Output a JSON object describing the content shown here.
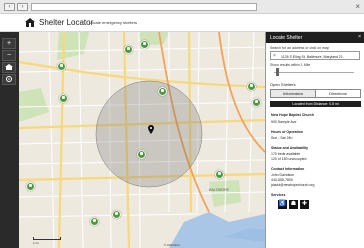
{
  "app": {
    "title": "Shelter Locator",
    "tagline": "Locate emergency shelters"
  },
  "left_bar": {
    "zoom_in": "+",
    "zoom_out": "−"
  },
  "map": {
    "street_labels": [],
    "district_label": "BALTIMORE",
    "scale_label": "1 mi",
    "attribution": "© 2014 Esri"
  },
  "panel": {
    "title": "Locate Shelter",
    "close": "×",
    "search_label": "Search for an address or click on map",
    "search_value": "1126 S Eling St, Baltimore, Maryland 21",
    "show_label": "Show results within 1 Mile",
    "open_shelters": "Open Shelters",
    "tabs": [
      "Information",
      "Directions"
    ],
    "status": "Located from Distance: 0.8 mi",
    "shelter": {
      "name": "New Hope Baptist Church",
      "address": "900 Sample Ave",
      "hours_label": "Hours of Operation",
      "hours": "Sun - Sat 24h",
      "status_label": "Status and Availability",
      "status_lines": [
        "170 beds available",
        "120 of 150 unoccupied"
      ],
      "contact_label": "Contact Information",
      "contact_lines": [
        "John Davidson",
        "443-555-7800",
        "jdavid@newhopechurch.org"
      ],
      "services_label": "Services"
    }
  }
}
